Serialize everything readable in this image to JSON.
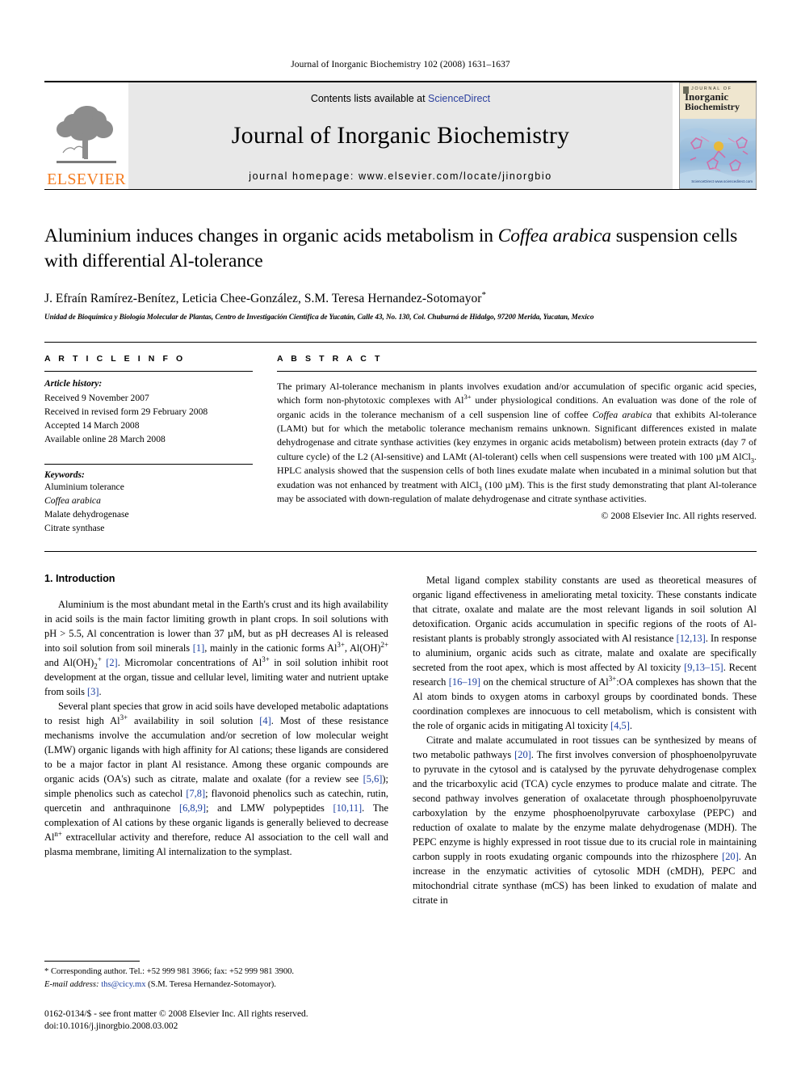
{
  "running_head": "Journal of Inorganic Biochemistry 102 (2008) 1631–1637",
  "masthead": {
    "publisher_wordmark": "ELSEVIER",
    "contents_prefix": "Contents lists available at ",
    "contents_link": "ScienceDirect",
    "journal_title": "Journal of Inorganic Biochemistry",
    "homepage": "journal homepage: www.elsevier.com/locate/jinorgbio",
    "cover": {
      "eyebrow": "JOURNAL OF",
      "line1": "Inorganic",
      "line2": "Biochemistry",
      "corner_mark": "ScienceDirect www.sciencedirect.com"
    },
    "link_color": "#2b3f9e",
    "wordmark_color": "#F47C20",
    "banner_bg": "#e8e8e8"
  },
  "title": {
    "line1_a": "Aluminium induces changes in organic acids metabolism in ",
    "line1_italic": "Coffea arabica",
    "line2": "suspension cells with differential Al-tolerance"
  },
  "authors": {
    "text": "J. Efraín Ramírez-Benítez, Leticia Chee-González, S.M. Teresa Hernandez-Sotomayor",
    "corresponding_mark": "*"
  },
  "affiliation": "Unidad de Bioquímica y Biología Molecular de Plantas, Centro de Investigación Científica de Yucatán, Calle 43, No. 130, Col. Chuburná de Hidalgo, 97200 Merida, Yucatan, Mexico",
  "article_info": {
    "heading": "A R T I C L E    I N F O",
    "history_label": "Article history:",
    "history": [
      "Received 9 November 2007",
      "Received in revised form 29 February 2008",
      "Accepted 14 March 2008",
      "Available online 28 March 2008"
    ],
    "keywords_label": "Keywords:",
    "keywords": [
      {
        "text": "Aluminium tolerance",
        "italic": false
      },
      {
        "text": "Coffea arabica",
        "italic": true
      },
      {
        "text": "Malate dehydrogenase",
        "italic": false
      },
      {
        "text": "Citrate synthase",
        "italic": false
      }
    ]
  },
  "abstract": {
    "heading": "A B S T R A C T",
    "paragraph_html": "The primary Al-tolerance mechanism in plants involves exudation and/or accumulation of specific organic acid species, which form non-phytotoxic complexes with Al<sup>3+</sup> under physiological conditions. An evaluation was done of the role of organic acids in the tolerance mechanism of a cell suspension line of coffee <span class=\"it\">Coffea arabica</span> that exhibits Al-tolerance (LAMt) but for which the metabolic tolerance mechanism remains unknown. Significant differences existed in malate dehydrogenase and citrate synthase activities (key enzymes in organic acids metabolism) between protein extracts (day 7 of culture cycle) of the L2 (Al-sensitive) and LAMt (Al-tolerant) cells when cell suspensions were treated with 100 &#181;M AlCl<sub>3</sub>. HPLC analysis showed that the suspension cells of both lines exudate malate when incubated in a minimal solution but that exudation was not enhanced by treatment with AlCl<sub>3</sub> (100 &#181;M). This is the first study demonstrating that plant Al-tolerance may be associated with down-regulation of malate dehydrogenase and citrate synthase activities.",
    "copyright": "© 2008 Elsevier Inc. All rights reserved."
  },
  "body": {
    "section_heading": "1. Introduction",
    "left_paragraphs_html": [
      "Aluminium is the most abundant metal in the Earth's crust and its high availability in acid soils is the main factor limiting growth in plant crops. In soil solutions with pH &gt; 5.5, Al concentration is lower than 37 &#181;M, but as pH decreases Al is released into soil solution from soil minerals <span class=\"ref\">[1]</span>, mainly in the cationic forms Al<sup>3+</sup>, Al(OH)<sup>2+</sup> and Al(OH)<sub>2</sub><sup>+</sup> <span class=\"ref\">[2]</span>. Micromolar concentrations of Al<sup>3+</sup> in soil solution inhibit root development at the organ, tissue and cellular level, limiting water and nutrient uptake from soils <span class=\"ref\">[3]</span>.",
      "Several plant species that grow in acid soils have developed metabolic adaptations to resist high Al<sup>3+</sup> availability in soil solution <span class=\"ref\">[4]</span>. Most of these resistance mechanisms involve the accumulation and/or secretion of low molecular weight (LMW) organic ligands with high affinity for Al cations; these ligands are considered to be a major factor in plant Al resistance. Among these organic compounds are organic acids (OA's) such as citrate, malate and oxalate (for a review see <span class=\"ref\">[5,6]</span>); simple phenolics such as catechol <span class=\"ref\">[7,8]</span>; flavonoid phenolics such as catechin, rutin, quercetin and anthraquinone <span class=\"ref\">[6,8,9]</span>; and LMW polypeptides <span class=\"ref\">[10,11]</span>. The complexation of Al cations by these organic ligands is generally believed to decrease Al<sup>n+</sup> extracellular activity and therefore, reduce Al association to the cell wall and plasma membrane, limiting Al internalization to the symplast."
    ],
    "right_paragraphs_html": [
      "Metal ligand complex stability constants are used as theoretical measures of organic ligand effectiveness in ameliorating metal toxicity. These constants indicate that citrate, oxalate and malate are the most relevant ligands in soil solution Al detoxification. Organic acids accumulation in specific regions of the roots of Al-resistant plants is probably strongly associated with Al resistance <span class=\"ref\">[12,13]</span>. In response to aluminium, organic acids such as citrate, malate and oxalate are specifically secreted from the root apex, which is most affected by Al toxicity <span class=\"ref\">[9,13–15]</span>. Recent research <span class=\"ref\">[16–19]</span> on the chemical structure of Al<sup>3+</sup>:OA complexes has shown that the Al atom binds to oxygen atoms in carboxyl groups by coordinated bonds. These coordination complexes are innocuous to cell metabolism, which is consistent with the role of organic acids in mitigating Al toxicity <span class=\"ref\">[4,5]</span>.",
      "Citrate and malate accumulated in root tissues can be synthesized by means of two metabolic pathways <span class=\"ref\">[20]</span>. The first involves conversion of phosphoenolpyruvate to pyruvate in the cytosol and is catalysed by the pyruvate dehydrogenase complex and the tricarboxylic acid (TCA) cycle enzymes to produce malate and citrate. The second pathway involves generation of oxalacetate through phosphoenolpyruvate carboxylation by the enzyme phosphoenolpyruvate carboxylase (PEPC) and reduction of oxalate to malate by the enzyme malate dehydrogenase (MDH). The PEPC enzyme is highly expressed in root tissue due to its crucial role in maintaining carbon supply in roots exudating organic compounds into the rhizosphere <span class=\"ref\">[20]</span>. An increase in the enzymatic activities of cytosolic MDH (cMDH), PEPC and mitochondrial citrate synthase (mCS) has been linked to exudation of malate and citrate in"
    ]
  },
  "footnotes": {
    "corresponding_html": "<span class=\"star\">*</span> Corresponding author. Tel.: +52 999 981 3966; fax: +52 999 981 3900.",
    "email_html": "<span class=\"it\">E-mail address:</span> <span class=\"email\">ths@cicy.mx</span> (S.M. Teresa Hernandez-Sotomayor).",
    "issn_line": "0162-0134/$ - see front matter © 2008 Elsevier Inc. All rights reserved.",
    "doi_line": "doi:10.1016/j.jinorgbio.2008.03.002"
  }
}
